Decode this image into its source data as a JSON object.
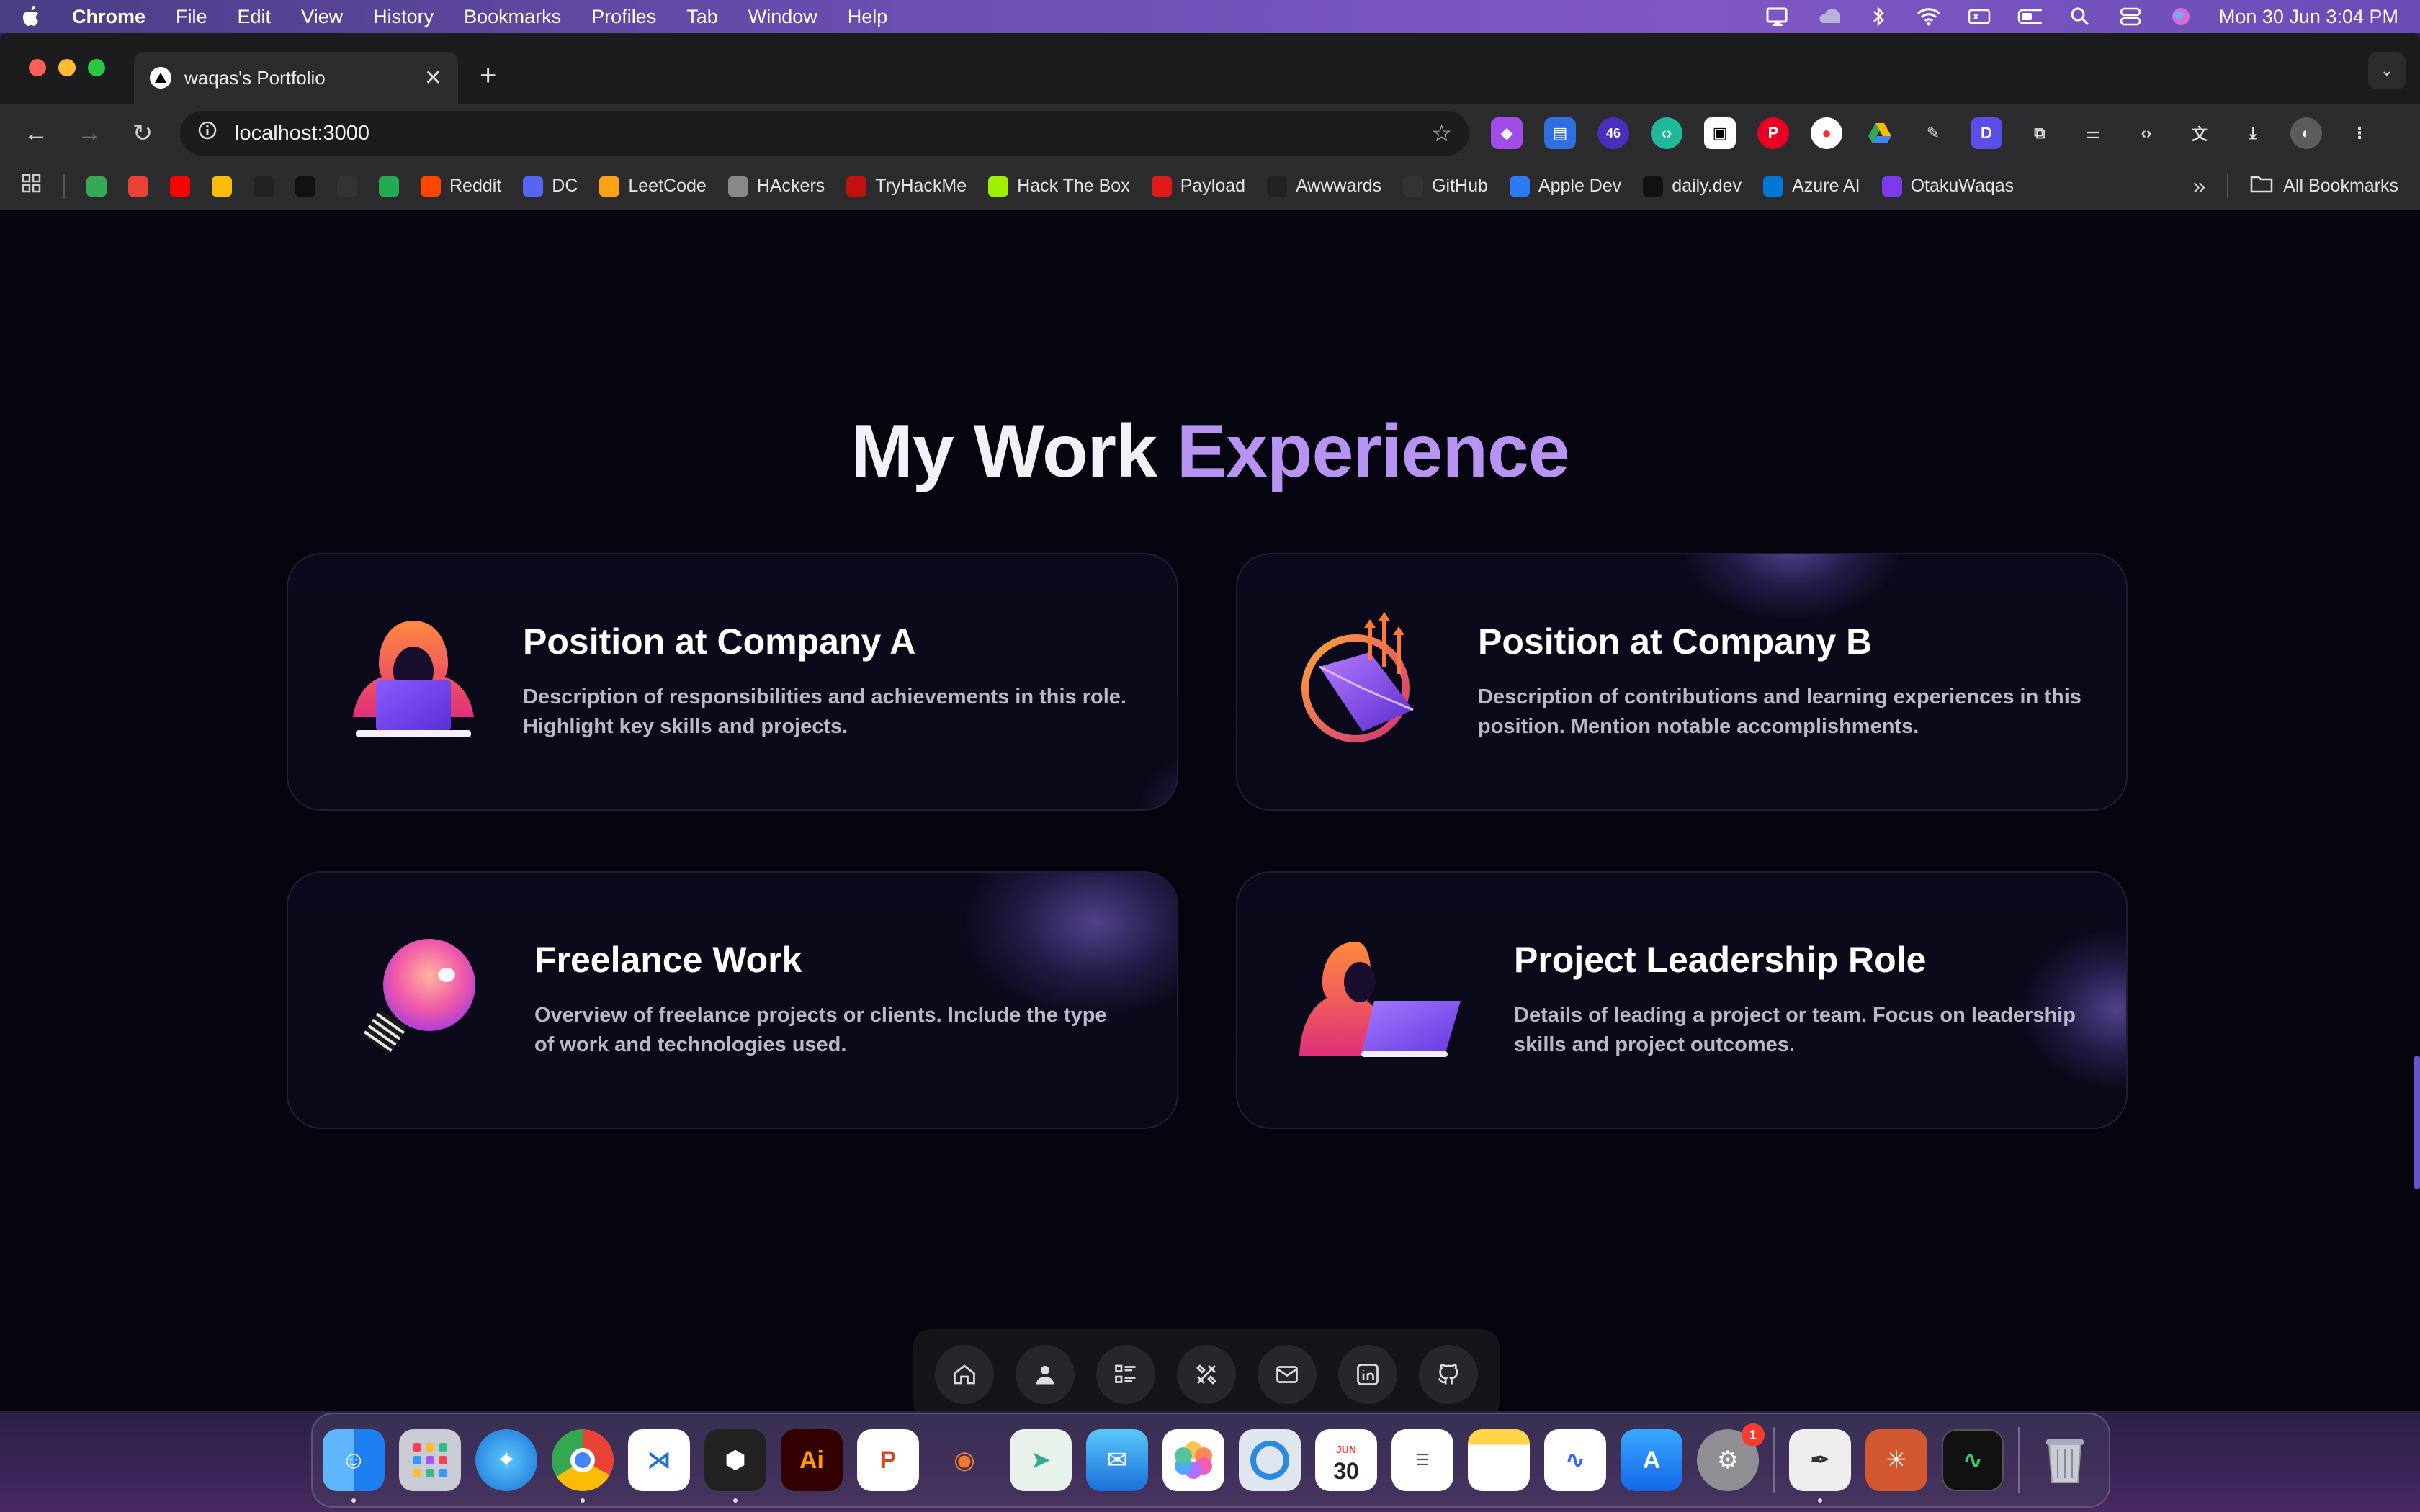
{
  "menubar": {
    "app_name": "Chrome",
    "items": [
      "File",
      "Edit",
      "View",
      "History",
      "Bookmarks",
      "Profiles",
      "Tab",
      "Window",
      "Help"
    ],
    "clock": "Mon 30 Jun  3:04 PM"
  },
  "browser": {
    "tab_title": "waqas's Portfolio",
    "new_tab_symbol": "+",
    "url": "localhost:3000",
    "extension_badge": "46",
    "bookmarks": [
      {
        "label": "",
        "color": "#34a853"
      },
      {
        "label": "",
        "color": "#ea4335"
      },
      {
        "label": "",
        "color": "#ff0000"
      },
      {
        "label": "",
        "color": "#fbbc05"
      },
      {
        "label": "",
        "color": "#222222"
      },
      {
        "label": "",
        "color": "#111111"
      },
      {
        "label": "",
        "color": "#333333"
      },
      {
        "label": "",
        "color": "#22aa55"
      },
      {
        "label": "Reddit",
        "color": "#ff4500"
      },
      {
        "label": "DC",
        "color": "#5865f2"
      },
      {
        "label": "LeetCode",
        "color": "#ffa116"
      },
      {
        "label": "HAckers",
        "color": "#888888"
      },
      {
        "label": "TryHackMe",
        "color": "#c11111"
      },
      {
        "label": "Hack The Box",
        "color": "#9fef00"
      },
      {
        "label": "Payload",
        "color": "#e01a1a"
      },
      {
        "label": "Awwwards",
        "color": "#222222"
      },
      {
        "label": "GitHub",
        "color": "#333333"
      },
      {
        "label": "Apple Dev",
        "color": "#2d7bf4"
      },
      {
        "label": "daily.dev",
        "color": "#111111"
      },
      {
        "label": "Azure AI",
        "color": "#0078d4"
      },
      {
        "label": "OtakuWaqas",
        "color": "#7c3aed"
      }
    ],
    "all_bookmarks": "All Bookmarks"
  },
  "page": {
    "heading_white": "My Work",
    "heading_accent": "Experience",
    "cards": [
      {
        "title": "Position at Company A",
        "description_line1": "Description of responsibilities and achievements in this role.",
        "description_line2": "Highlight key skills and projects.",
        "icon": "hacker-laptop-icon"
      },
      {
        "title": "Position at Company B",
        "description_line1": "Description of contributions and learning experiences in this",
        "description_line2": "position. Mention notable accomplishments.",
        "icon": "growth-chart-icon"
      },
      {
        "title": "Freelance Work",
        "description_line1": "Overview of freelance projects or clients. Include the type",
        "description_line2": "of work and technologies used.",
        "icon": "lightbulb-icon"
      },
      {
        "title": "Project Leadership Role",
        "description_line1": "Details of leading a project or team. Focus on leadership",
        "description_line2": "skills and project outcomes.",
        "icon": "hooded-figure-laptop-icon"
      }
    ],
    "nav_dock": [
      "home-icon",
      "user-icon",
      "list-icon",
      "tools-icon",
      "mail-icon",
      "linkedin-icon",
      "github-icon"
    ]
  },
  "mac_dock": {
    "calendar_month": "JUN",
    "calendar_day": "30",
    "settings_badge": "1",
    "illustrator_label": "Ai"
  },
  "colors": {
    "accent": "#b793f2",
    "page_bg": "#05050f",
    "card_bg": "#0b0a1c"
  }
}
